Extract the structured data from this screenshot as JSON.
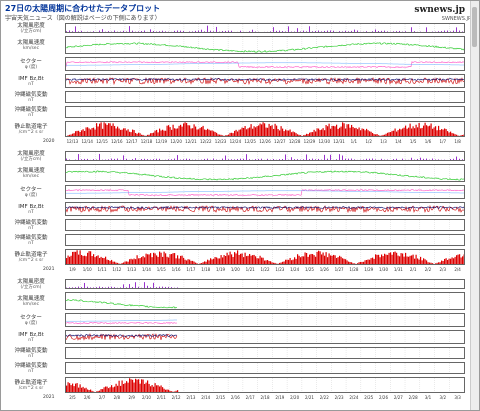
{
  "page": {
    "title": "27日の太陽周期に合わせたデータプロット",
    "subtitle": "宇宙天気ニュース（図の解説はページの下側にあります）",
    "logo": "swnews.jp",
    "logo_sub": "SWNEWS.JP"
  },
  "row_labels": [
    {
      "main": "太陽風密度",
      "sub": "(/立方cm)"
    },
    {
      "main": "太陽風速度",
      "sub": "km/sec"
    },
    {
      "main": "セクター",
      "sub": "φ (度)"
    },
    {
      "main": "IMF Bz,Bt",
      "sub": "nT"
    },
    {
      "main": "沖縄磁気変動",
      "sub": "nT"
    },
    {
      "main": "沖縄磁気変動",
      "sub": "nT"
    },
    {
      "main": "静止軌道電子",
      "sub": "/cm^2 s sr"
    }
  ],
  "panels": [
    {
      "year": "2020",
      "ticks": [
        "12/13",
        "12/14",
        "12/15",
        "12/16",
        "12/17",
        "12/18",
        "12/19",
        "12/20",
        "12/21",
        "12/22",
        "12/23",
        "12/24",
        "12/25",
        "12/26",
        "12/27",
        "12/28",
        "12/29",
        "12/30",
        "12/31",
        "1/1",
        "1/2",
        "1/3",
        "1/4",
        "1/5",
        "1/6",
        "1/7",
        "1/8"
      ]
    },
    {
      "year": "2021",
      "ticks": [
        "1/9",
        "1/10",
        "1/11",
        "1/12",
        "1/13",
        "1/14",
        "1/15",
        "1/16",
        "1/17",
        "1/18",
        "1/19",
        "1/20",
        "1/21",
        "1/22",
        "1/23",
        "1/24",
        "1/25",
        "1/26",
        "1/27",
        "1/28",
        "1/29",
        "1/30",
        "1/31",
        "2/1",
        "2/2",
        "2/3",
        "2/4"
      ]
    },
    {
      "year": "2021",
      "ticks": [
        "2/5",
        "2/6",
        "2/7",
        "2/8",
        "2/9",
        "2/10",
        "2/11",
        "2/12",
        "2/13",
        "2/14",
        "2/15",
        "2/16",
        "2/17",
        "2/18",
        "2/19",
        "2/20",
        "2/21",
        "2/22",
        "2/23",
        "2/24",
        "2/25",
        "2/26",
        "2/27",
        "2/28",
        "3/1",
        "3/2",
        "3/3"
      ]
    }
  ],
  "colors": {
    "density": "#9933cc",
    "speed": "#33cc33",
    "sector": "#ff66cc",
    "sector_alt": "#66aaff",
    "imf_bz": "#cc0000",
    "imf_bt": "#000066",
    "electron": "#dd0000"
  }
}
